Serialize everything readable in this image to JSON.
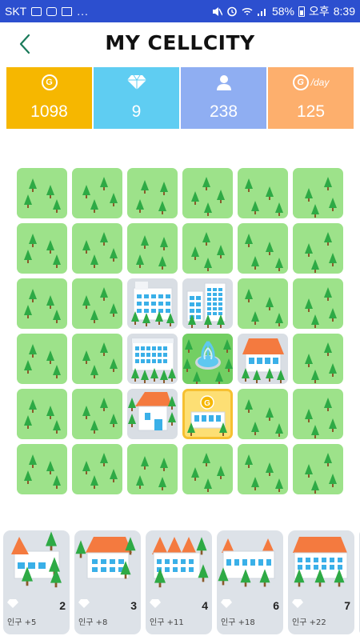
{
  "status_bar": {
    "carrier": "SKT",
    "extra": "...",
    "battery": "58%",
    "ampm": "오후",
    "time": "8:39"
  },
  "header": {
    "title": "MY CELLCITY",
    "back_icon": "chevron-left-icon"
  },
  "stats": [
    {
      "name": "coins",
      "icon": "coin-icon",
      "icon_text": "G",
      "value": "1098",
      "color": "#f6b700"
    },
    {
      "name": "gems",
      "icon": "diamond-icon",
      "value": "9",
      "color": "#5fcdf2"
    },
    {
      "name": "population",
      "icon": "person-icon",
      "value": "238",
      "color": "#8faef2"
    },
    {
      "name": "income",
      "icon": "coin-icon",
      "icon_text": "G",
      "suffix": "/day",
      "value": "125",
      "color": "#fdaf6d"
    }
  ],
  "grid": {
    "rows": 6,
    "cols": 6,
    "tiles": [
      [
        "grass",
        "grass",
        "grass",
        "grass",
        "grass",
        "grass"
      ],
      [
        "grass",
        "grass",
        "grass",
        "grass",
        "grass",
        "grass"
      ],
      [
        "grass",
        "grass",
        "apartment",
        "tower",
        "grass",
        "grass"
      ],
      [
        "grass",
        "grass",
        "office",
        "fountain-park",
        "house-red",
        "grass"
      ],
      [
        "grass",
        "grass",
        "house-small",
        "coin-shop",
        "grass",
        "grass"
      ],
      [
        "grass",
        "grass",
        "grass",
        "grass",
        "grass",
        "grass"
      ]
    ],
    "coin_badge": "G"
  },
  "shop": {
    "items": [
      {
        "name": "house-1",
        "price": "2",
        "population": "인구 +5"
      },
      {
        "name": "house-2",
        "price": "3",
        "population": "인구 +8"
      },
      {
        "name": "townhouse",
        "price": "4",
        "population": "인구 +11"
      },
      {
        "name": "villa",
        "price": "6",
        "population": "인구 +18"
      },
      {
        "name": "mansion",
        "price": "7",
        "population": "인구 +22"
      }
    ],
    "price_icon": "diamond-icon"
  }
}
